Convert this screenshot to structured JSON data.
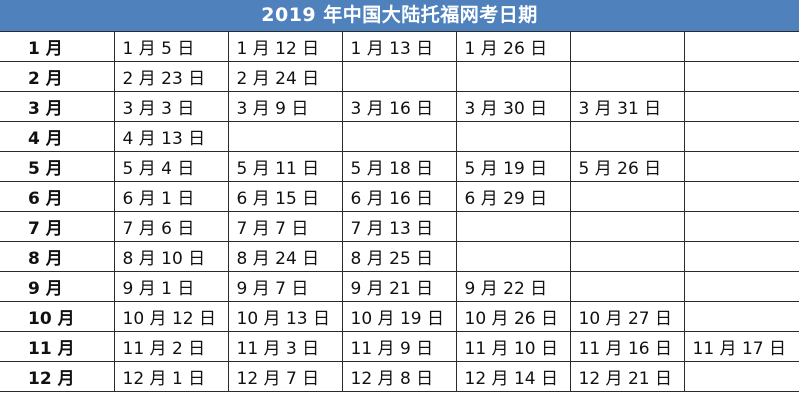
{
  "title": "2019 年中国大陆托福网考日期",
  "colors": {
    "header_background": "#4f81bd",
    "header_text": "#ffffff",
    "grid_line": "#2b2b2b"
  },
  "rows": [
    {
      "month": "1 月",
      "dates": [
        "1 月 5 日",
        "1 月 12 日",
        "1 月 13 日",
        "1 月 26 日",
        "",
        ""
      ]
    },
    {
      "month": "2 月",
      "dates": [
        "2 月 23 日",
        "2 月 24 日",
        "",
        "",
        "",
        ""
      ]
    },
    {
      "month": "3 月",
      "dates": [
        "3 月 3 日",
        "3 月 9 日",
        "3 月 16 日",
        "3 月 30 日",
        "3 月 31 日",
        ""
      ]
    },
    {
      "month": "4 月",
      "dates": [
        "4 月 13 日",
        "",
        "",
        "",
        "",
        ""
      ]
    },
    {
      "month": "5 月",
      "dates": [
        "5 月 4 日",
        "5 月 11 日",
        "5 月 18 日",
        "5 月 19 日",
        "5 月 26 日",
        ""
      ]
    },
    {
      "month": "6 月",
      "dates": [
        "6 月 1 日",
        "6 月 15 日",
        "6 月 16 日",
        "6 月 29 日",
        "",
        ""
      ]
    },
    {
      "month": "7 月",
      "dates": [
        "7 月 6 日",
        "7 月 7 日",
        "7 月 13 日",
        "",
        "",
        ""
      ]
    },
    {
      "month": "8 月",
      "dates": [
        "8 月 10 日",
        "8 月 24 日",
        "8 月 25 日",
        "",
        "",
        ""
      ]
    },
    {
      "month": "9 月",
      "dates": [
        "9 月 1 日",
        "9 月 7 日",
        "9 月 21 日",
        "9 月 22 日",
        "",
        ""
      ]
    },
    {
      "month": "10 月",
      "dates": [
        "10 月 12 日",
        "10 月 13 日",
        "10 月 19 日",
        "10 月 26 日",
        "10 月 27 日",
        ""
      ]
    },
    {
      "month": "11 月",
      "dates": [
        "11 月 2 日",
        "11 月 3 日",
        "11 月 9 日",
        "11 月 10 日",
        "11 月 16 日",
        "11 月 17 日"
      ]
    },
    {
      "month": "12 月",
      "dates": [
        "12 月 1 日",
        "12 月 7 日",
        "12 月 8 日",
        "12 月 14 日",
        "12 月 21 日",
        ""
      ]
    }
  ]
}
